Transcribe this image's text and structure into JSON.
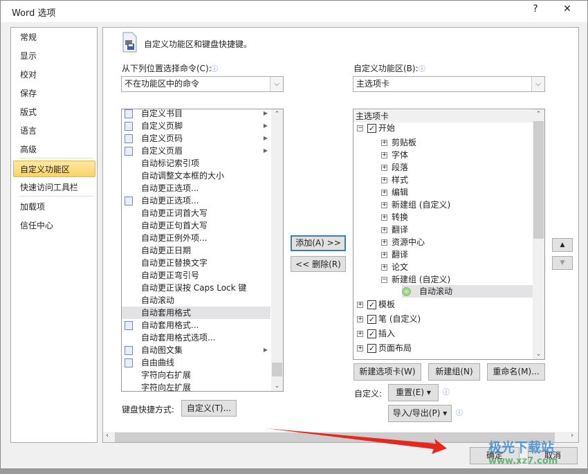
{
  "window": {
    "title": "Word 选项",
    "help": "?",
    "close": "✕"
  },
  "nav": {
    "items": [
      "常规",
      "显示",
      "校对",
      "保存",
      "版式",
      "语言",
      "高级",
      "自定义功能区",
      "快速访问工具栏",
      "加载项",
      "信任中心"
    ],
    "selected": "自定义功能区"
  },
  "header": {
    "title": "自定义功能区和键盘快捷键。"
  },
  "left": {
    "label": "从下列位置选择命令(C):",
    "select_value": "不在功能区中的命令",
    "items": [
      {
        "label": "自定义书目",
        "icon": "building-blocks-icon",
        "submenu": true
      },
      {
        "label": "自定义页脚",
        "icon": "footer-icon",
        "submenu": true
      },
      {
        "label": "自定义页码",
        "icon": "page-number-icon",
        "submenu": true
      },
      {
        "label": "自定义页眉",
        "icon": "header-icon",
        "submenu": true
      },
      {
        "label": "自动标记索引项"
      },
      {
        "label": "自动调整文本框的大小"
      },
      {
        "label": "自动更正选项..."
      },
      {
        "label": "自动更正选项...",
        "icon": "autocorrect-icon"
      },
      {
        "label": "自动更正词首大写"
      },
      {
        "label": "自动更正句首大写"
      },
      {
        "label": "自动更正例外项..."
      },
      {
        "label": "自动更正日期"
      },
      {
        "label": "自动更正替换文字"
      },
      {
        "label": "自动更正弯引号"
      },
      {
        "label": "自动更正误按 Caps Lock 键"
      },
      {
        "label": "自动滚动"
      },
      {
        "label": "自动套用格式",
        "selected": true
      },
      {
        "label": "自动套用格式...",
        "icon": "autoformat-icon"
      },
      {
        "label": "自动套用格式选项..."
      },
      {
        "label": "自动图文集",
        "icon": "autotext-icon",
        "submenu": true
      },
      {
        "label": "自由曲线",
        "icon": "freeform-icon"
      },
      {
        "label": "字符向右扩展"
      },
      {
        "label": "字符向左扩展"
      }
    ],
    "shortcut_label": "键盘快捷方式:",
    "shortcut_button": "自定义(T)..."
  },
  "middle": {
    "add": "添加(A) >>",
    "remove": "<< 删除(R)"
  },
  "right": {
    "label": "自定义功能区(B):",
    "select_value": "主选项卡",
    "tree": [
      {
        "label": "主选项卡",
        "level": 0,
        "header": true
      },
      {
        "label": "开始",
        "level": 0,
        "expander": "−",
        "checked": true
      },
      {
        "label": "剪贴板",
        "level": 1,
        "expander": "+"
      },
      {
        "label": "字体",
        "level": 1,
        "expander": "+"
      },
      {
        "label": "段落",
        "level": 1,
        "expander": "+"
      },
      {
        "label": "样式",
        "level": 1,
        "expander": "+"
      },
      {
        "label": "编辑",
        "level": 1,
        "expander": "+"
      },
      {
        "label": "新建组 (自定义)",
        "level": 1,
        "expander": "+"
      },
      {
        "label": "转换",
        "level": 1,
        "expander": "+"
      },
      {
        "label": "翻译",
        "level": 1,
        "expander": "+"
      },
      {
        "label": "资源中心",
        "level": 1,
        "expander": "+"
      },
      {
        "label": "翻译",
        "level": 1,
        "expander": "+"
      },
      {
        "label": "论文",
        "level": 1,
        "expander": "+"
      },
      {
        "label": "新建组 (自定义)",
        "level": 1,
        "expander": "−"
      },
      {
        "label": "自动滚动",
        "level": 2,
        "selected": true
      },
      {
        "label": "模板",
        "level": 0,
        "expander": "+",
        "checked": true
      },
      {
        "label": "笔 (自定义)",
        "level": 0,
        "expander": "+",
        "checked": true
      },
      {
        "label": "插入",
        "level": 0,
        "expander": "+",
        "checked": true
      },
      {
        "label": "页面布局",
        "level": 0,
        "expander": "+",
        "checked": true
      }
    ],
    "new_tab": "新建选项卡(W)",
    "new_group": "新建组(N)",
    "rename": "重命名(M)...",
    "customize_label": "自定义:",
    "reset": "重置(E) ▾",
    "import_export": "导入/导出(P) ▾"
  },
  "footer": {
    "ok": "确定",
    "cancel": "取消"
  },
  "watermark": {
    "name": "极光下载站",
    "url": "www.xz7.com"
  },
  "colors": {
    "nav_selected": "#f9d466",
    "annotation_arrow": "#e8261c",
    "focus_border": "#3c7fb1"
  }
}
